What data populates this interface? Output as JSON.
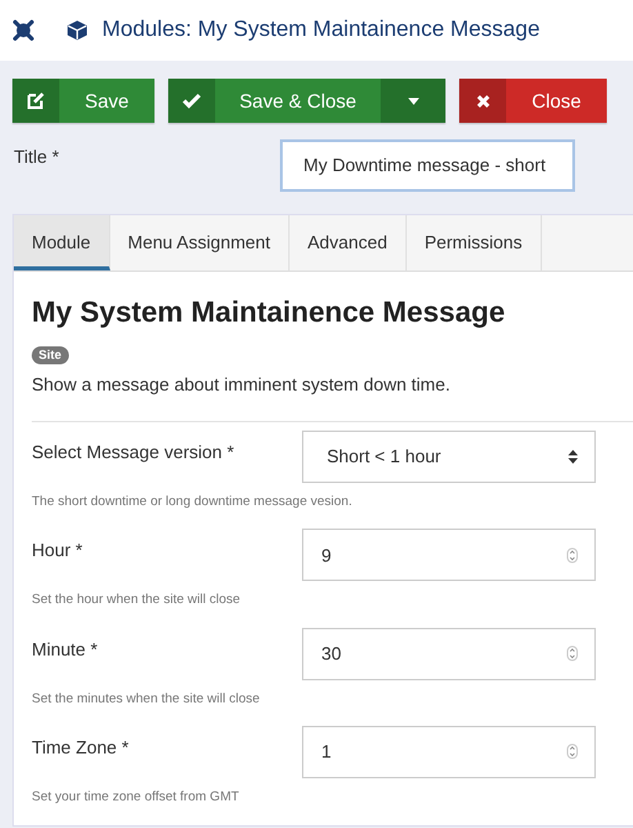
{
  "header": {
    "title": "Modules: My System Maintainence Message"
  },
  "toolbar": [
    {
      "kind": "save",
      "label": "Save"
    },
    {
      "kind": "save_close",
      "label": "Save & Close"
    },
    {
      "kind": "close",
      "label": "Close"
    }
  ],
  "title_field": {
    "label": "Title *",
    "value": "My Downtime message - short",
    "focused": true
  },
  "tabs": [
    {
      "label": "Module",
      "selected": true
    },
    {
      "label": "Menu Assignment",
      "selected": false
    },
    {
      "label": "Advanced",
      "selected": false
    },
    {
      "label": "Permissions",
      "selected": false
    }
  ],
  "module": {
    "heading": "My System Maintainence Message",
    "badge": "Site",
    "description": "Show a message about imminent system down time."
  },
  "fields": [
    {
      "kind": "select",
      "label": "Select Message version *",
      "value": "Short < 1 hour",
      "help": "The short downtime or long downtime message vesion."
    },
    {
      "kind": "number",
      "label": "Hour *",
      "value": "9",
      "help": "Set the hour when the site will close"
    },
    {
      "kind": "number",
      "label": "Minute *",
      "value": "30",
      "help": "Set the minutes when the site will close"
    },
    {
      "kind": "number",
      "label": "Time Zone *",
      "value": "1",
      "help": "Set your time zone offset from GMT"
    }
  ]
}
